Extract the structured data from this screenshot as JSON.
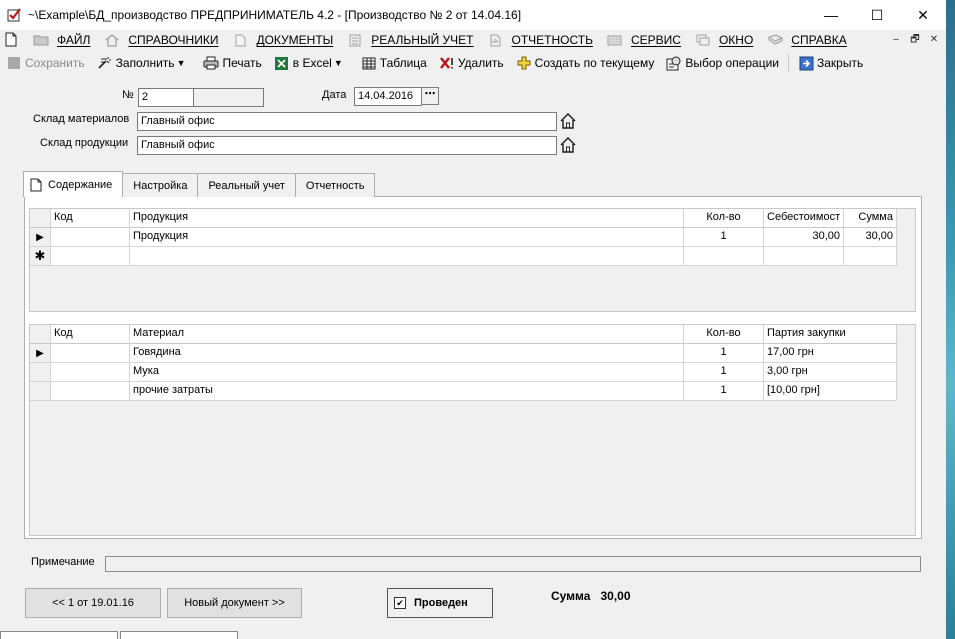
{
  "window": {
    "title": "~\\Example\\БД_производство  ПРЕДПРИНИМАТЕЛЬ 4.2 - [Производство № 2 от 14.04.16]",
    "controls": [
      "—",
      "☐",
      "✕"
    ]
  },
  "menu": {
    "items": [
      {
        "label": "Файл",
        "icon": "folder-icon"
      },
      {
        "label": "Справочники",
        "icon": "home-icon"
      },
      {
        "label": "Документы",
        "icon": "document-icon"
      },
      {
        "label": "Реальный учет",
        "icon": "ledger-icon"
      },
      {
        "label": "Отчетность",
        "icon": "report-icon"
      },
      {
        "label": "Сервис",
        "icon": "keyboard-icon"
      },
      {
        "label": "Окно",
        "icon": "window-icon"
      },
      {
        "label": "Справка",
        "icon": "book-icon"
      }
    ],
    "mdi_controls": [
      "–",
      "🗗",
      "✕"
    ]
  },
  "toolbar": {
    "save": "Сохранить",
    "fill": "Заполнить",
    "print": "Печать",
    "excel": "в Excel",
    "table": "Таблица",
    "delete": "Удалить",
    "create_from_current": "Создать по текущему",
    "select_operation": "Выбор операции",
    "close": "Закрыть"
  },
  "form": {
    "number_label": "№",
    "number_value": "2",
    "date_label": "Дата",
    "date_value": "14.04.2016",
    "materials_warehouse_label": "Склад материалов",
    "materials_warehouse_value": "Главный офис",
    "products_warehouse_label": "Склад продукции",
    "products_warehouse_value": "Главный офис"
  },
  "tabs": [
    {
      "label": "Содержание",
      "active": true
    },
    {
      "label": "Настройка",
      "active": false
    },
    {
      "label": "Реальный учет",
      "active": false
    },
    {
      "label": "Отчетность",
      "active": false
    }
  ],
  "products_grid": {
    "columns": [
      "Код",
      "Продукция",
      "Кол-во",
      "Себестоимост",
      "Сумма"
    ],
    "rows": [
      {
        "code": "",
        "name": "Продукция",
        "qty": "1",
        "cost": "30,00",
        "sum": "30,00"
      }
    ]
  },
  "materials_grid": {
    "columns": [
      "Код",
      "Материал",
      "Кол-во",
      "Партия закупки"
    ],
    "rows": [
      {
        "code": "",
        "name": "Говядина",
        "qty": "1",
        "batch": "17,00 грн"
      },
      {
        "code": "",
        "name": "Мука",
        "qty": "1",
        "batch": "3,00 грн"
      },
      {
        "code": "",
        "name": "прочие затраты",
        "qty": "1",
        "batch": "[10,00 грн]"
      }
    ]
  },
  "footer": {
    "note_label": "Примечание",
    "prev_button": "<< 1 от 19.01.16",
    "new_doc_button": "Новый документ >>",
    "posted_label": "Проведен",
    "posted_checked": true,
    "sum_label": "Сумма",
    "sum_value": "30,00"
  }
}
